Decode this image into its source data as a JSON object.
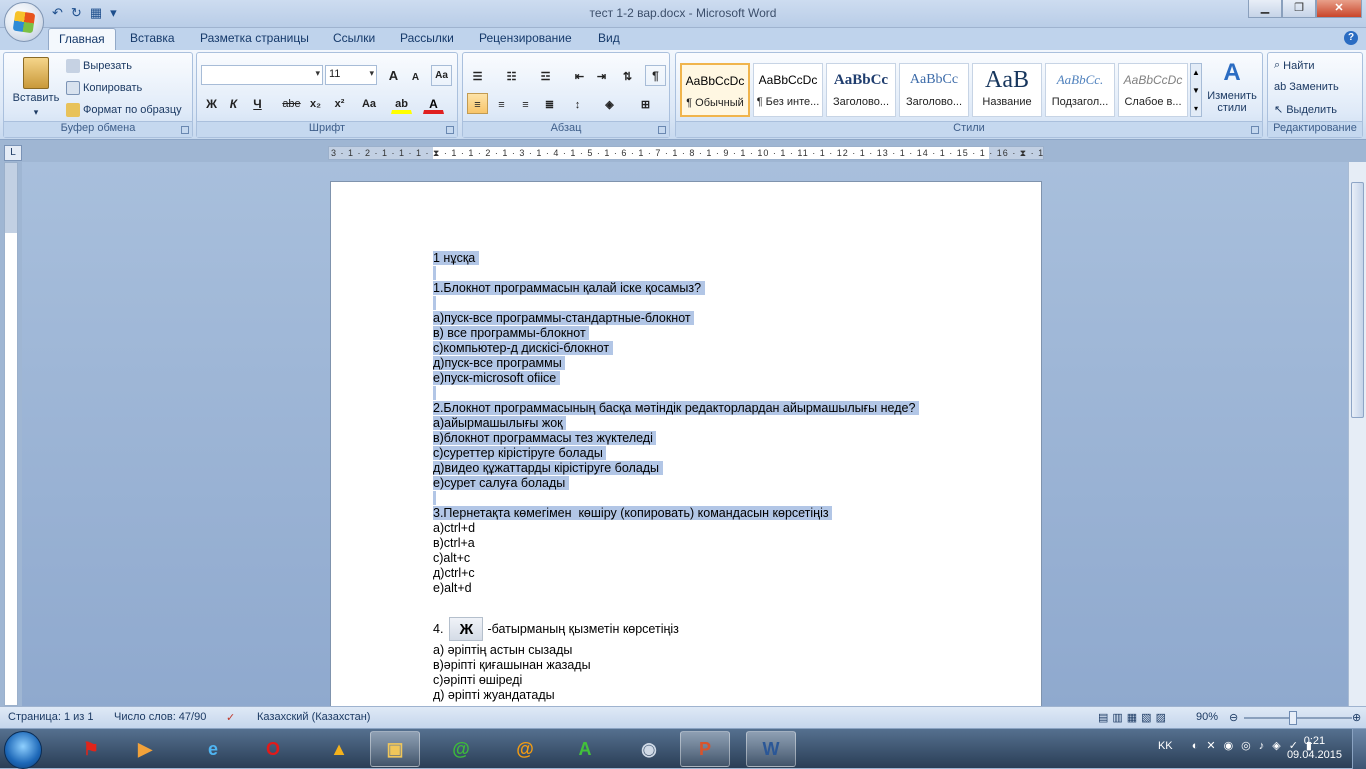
{
  "window": {
    "title": "тест 1-2 вар.docx - Microsoft Word",
    "controls": {
      "minimize": "▁",
      "maximize": "❐",
      "close": "✕"
    },
    "qat": [
      "↶",
      "↻",
      "▦",
      "▾"
    ]
  },
  "tabs": [
    "Главная",
    "Вставка",
    "Разметка страницы",
    "Ссылки",
    "Рассылки",
    "Рецензирование",
    "Вид"
  ],
  "clipboard": {
    "label": "Буфер обмена",
    "paste": "Вставить",
    "cut": "Вырезать",
    "copy": "Копировать",
    "format_painter": "Формат по образцу"
  },
  "font": {
    "label": "Шрифт",
    "name": "",
    "size": "11",
    "grow": "A",
    "shrink": "A",
    "clear": "Aa",
    "bold": "Ж",
    "italic": "К",
    "underline": "Ч",
    "strike": "abe",
    "subscript": "x₂",
    "superscript": "x²",
    "case": "Aa",
    "highlight": "ab",
    "color": "A"
  },
  "paragraph": {
    "label": "Абзац",
    "pilcrow": "¶"
  },
  "styles": {
    "label": "Стили",
    "change": "Изменить стили",
    "items": [
      {
        "sample": "AaBbCcDc",
        "name": "¶ Обычный"
      },
      {
        "sample": "AaBbCcDc",
        "name": "¶ Без инте..."
      },
      {
        "sample": "AaBbCc",
        "name": "Заголово..."
      },
      {
        "sample": "AaBbCc",
        "name": "Заголово..."
      },
      {
        "sample": "AaB",
        "name": "Название"
      },
      {
        "sample": "AaBbCc.",
        "name": "Подзагол..."
      },
      {
        "sample": "AaBbCcDc",
        "name": "Слабое в..."
      }
    ]
  },
  "editing": {
    "label": "Редактирование",
    "find": "Найти",
    "replace": "Заменить",
    "select": "Выделить"
  },
  "ruler": {
    "corner": "L",
    "marks": "3 · 1 · 2 · 1 · 1 · 1 · ⧗ · 1 · 1 · 2 · 1 · 3 · 1 · 4 · 1 · 5 · 1 · 6 · 1 · 7 · 1 · 8 · 1 · 9 · 1 · 10 · 1 · 11 · 1 · 12 · 1 · 13 · 1 · 14 · 1 · 15 · 1 · 16 · ⧗ · 17 ·"
  },
  "document": {
    "lines": [
      {
        "text": "1 нұсқа ",
        "hl": true
      },
      {
        "text": " ",
        "hl": true
      },
      {
        "text": "1.Блокнот программасын қалай іске қосамыз? ",
        "hl": true
      },
      {
        "text": " ",
        "hl": true
      },
      {
        "text": "а)пуск-все программы-стандартные-блокнот ",
        "hl": true
      },
      {
        "text": "в) все программы-блокнот ",
        "hl": true
      },
      {
        "text": "с)компьютер-д дискісі-блокнот ",
        "hl": true
      },
      {
        "text": "д)пуск-все программы ",
        "hl": true
      },
      {
        "text": "е)пуск-microsoft ofiice ",
        "hl": true
      },
      {
        "text": " ",
        "hl": true
      },
      {
        "text": "2.Блокнот программасының басқа мәтіндік редакторлардан айырмашылығы неде? ",
        "hl": true
      },
      {
        "text": "а)айырмашылығы жоқ ",
        "hl": true
      },
      {
        "text": "в)блокнот программасы тез жүктеледі ",
        "hl": true
      },
      {
        "text": "с)суреттер кірістіруге болады ",
        "hl": true
      },
      {
        "text": "д)видео құжаттарды кірістіруге болады ",
        "hl": true
      },
      {
        "text": "е)сурет салуға болады ",
        "hl": true
      },
      {
        "text": " ",
        "hl": true
      },
      {
        "text": "3.Пернетақта көмегімен  көшіру (копировать) командасын көрсетіңіз ",
        "hl": true
      },
      {
        "text": "а)ctrl+d",
        "hl": false
      },
      {
        "text": "в)ctrl+a",
        "hl": false
      },
      {
        "text": "с)alt+c",
        "hl": false
      },
      {
        "text": "д)ctrl+c",
        "hl": false
      },
      {
        "text": "е)alt+d",
        "hl": false
      }
    ],
    "q4_prefix": "4.",
    "q4_button": "Ж",
    "q4_suffix": "-батырманың қызметін көрсетіңіз",
    "q4_lines": [
      "а) әріптің астын сызады",
      "в)әріпті қиғашынан жазады",
      "с)әріпті өшіреді",
      "д) әріпті жуандатады"
    ]
  },
  "status": {
    "page": "Страница: 1 из 1",
    "words": "Число слов: 47/90",
    "language": "Казахский (Казахстан)",
    "zoom": "90%",
    "zoom_fraction": 0.45
  },
  "taskbar": {
    "apps": [
      "pdf-icon",
      "media-icon",
      "ie-icon",
      "opera-icon",
      "aimp-icon",
      "explorer-icon",
      "mail-icon",
      "agent-icon",
      "green-a-icon",
      "camera-icon",
      "powerpoint-icon",
      "word-icon"
    ],
    "lang": "KK",
    "time": "0:21",
    "date": "09.04.2015"
  }
}
